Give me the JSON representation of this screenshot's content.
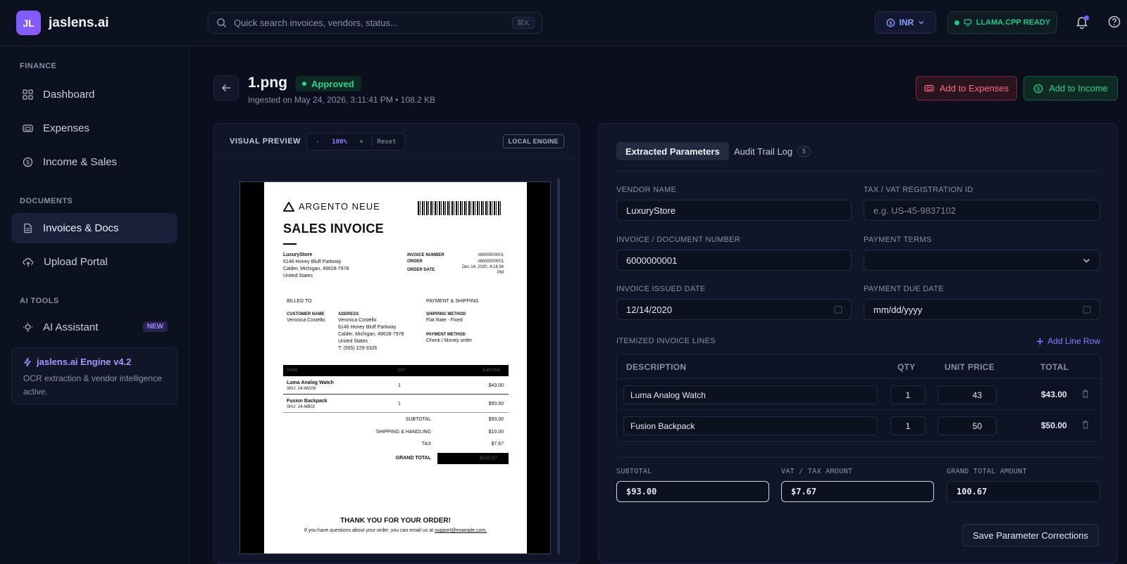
{
  "brand": {
    "logo": "JL",
    "name": "jaslens.ai"
  },
  "search": {
    "placeholder": "Quick search invoices, vendors, status...",
    "shortcut": "⌘K"
  },
  "topbar": {
    "currency": "INR",
    "llama_status": "LLAMA.CPP READY"
  },
  "sidebar": {
    "sections": [
      {
        "title": "FINANCE"
      },
      {
        "title": "DOCUMENTS"
      },
      {
        "title": "AI TOOLS"
      }
    ],
    "items": [
      {
        "label": "Dashboard",
        "icon": "grid-icon"
      },
      {
        "label": "Expenses",
        "icon": "wallet-icon"
      },
      {
        "label": "Income & Sales",
        "icon": "dollar-circle-icon"
      },
      {
        "label": "Invoices & Docs",
        "icon": "document-icon",
        "active": true
      },
      {
        "label": "Upload Portal",
        "icon": "cloud-upload-icon"
      },
      {
        "label": "AI Assistant",
        "icon": "lightbulb-icon",
        "badge": "NEW"
      }
    ],
    "engine": {
      "title": "jaslens.ai Engine v4.2",
      "desc": "OCR extraction & vendor intelligence active."
    }
  },
  "header": {
    "file_name": "1.png",
    "status": "Approved",
    "ingested": "Ingested on May 24, 2026, 3:11:41 PM • 108.2 KB",
    "add_expenses": "Add to Expenses",
    "add_income": "Add to Income"
  },
  "preview": {
    "label": "VISUAL PREVIEW",
    "zoom_minus": "-",
    "zoom_level": "100%",
    "zoom_plus": "+",
    "reset": "Reset",
    "engine_tag": "LOCAL ENGINE",
    "paper": {
      "brand": "ARGENTO NEUE",
      "title": "SALES INVOICE",
      "vendor": "LuxuryStore",
      "vendor_addr1": "6146 Honey Bluff Parkway",
      "vendor_addr2": "Calder, Michigan, 49628-7978",
      "vendor_addr3": "United States",
      "inv_label": "INVOICE NUMBER",
      "order_label": "ORDER",
      "date_label": "ORDER DATE",
      "inv_value": "#6000000001",
      "order_value": "#6000000001",
      "date_value": "Dec 14, 2020, 4:18:34 PM",
      "billed_to": "BILLED TO",
      "payment_shipping": "PAYMENT & SHIPPING",
      "customer_label": "CUSTOMER NAME",
      "customer": "Veronica Costello",
      "address_label": "ADDRESS",
      "addr1": "Veronica Costello",
      "addr2": "6146 Honey Bluff Parkway",
      "addr3": "Calder, Michigan, 49628-7978",
      "addr4": "United States",
      "addr5": "T: (555) 229-3326",
      "ship_method_label": "SHIPPING METHOD",
      "ship_method": "Flat Rate - Fixed",
      "pay_method_label": "PAYMENT METHOD",
      "pay_method": "Check / Money order",
      "th_item": "ITEMS",
      "th_qty": "QTY",
      "th_subtotal": "SUBTOTAL",
      "item1": "Luma Analog Watch",
      "sku1": "SKU: 24-WG09",
      "qty1": "1",
      "price1": "$43.00",
      "item2": "Fusion Backpack",
      "sku2": "SKU: 24-MB02",
      "qty2": "1",
      "price2": "$50.00",
      "subtotal_label": "SUBTOTAL",
      "subtotal": "$93.00",
      "shipping_label": "SHIPPING & HANDLING",
      "shipping": "$10.00",
      "tax_label": "TAX",
      "tax": "$7.67",
      "grand_label": "GRAND TOTAL",
      "grand": "$110.67",
      "thanks": "THANK YOU FOR YOUR ORDER!",
      "footer": "If you have questions about your order, you can email us at",
      "footer_email": "support@example.com."
    }
  },
  "params": {
    "tab_extracted": "Extracted Parameters",
    "tab_audit": "Audit Trail Log",
    "audit_count": "5",
    "vendor_label": "VENDOR NAME",
    "vendor_value": "LuxuryStore",
    "tax_id_label": "TAX / VAT REGISTRATION ID",
    "tax_id_placeholder": "e.g. US-45-9837102",
    "invoice_no_label": "INVOICE / DOCUMENT NUMBER",
    "invoice_no_value": "6000000001",
    "terms_label": "PAYMENT TERMS",
    "terms_value": "",
    "issued_label": "INVOICE ISSUED DATE",
    "issued_value": "12/14/2020",
    "due_label": "PAYMENT DUE DATE",
    "due_value": "mm/dd/yyyy",
    "lines_label": "ITEMIZED INVOICE LINES",
    "add_line": "Add Line Row",
    "columns": {
      "description": "DESCRIPTION",
      "qty": "QTY",
      "unit_price": "UNIT PRICE",
      "total": "TOTAL"
    },
    "lines": [
      {
        "description": "Luma Analog Watch",
        "qty": "1",
        "unit_price": "43",
        "total": "$43.00"
      },
      {
        "description": "Fusion Backpack",
        "qty": "1",
        "unit_price": "50",
        "total": "$50.00"
      }
    ],
    "subtotal_label": "SUBTOTAL",
    "subtotal_value": "$93.00",
    "vat_label": "VAT / TAX AMOUNT",
    "vat_value": "$7.67",
    "grand_label": "GRAND TOTAL AMOUNT",
    "grand_value": "100.67",
    "save": "Save Parameter Corrections"
  },
  "colors": {
    "accent": "#7c5cff",
    "success": "#22c58e",
    "danger": "#ff6b82",
    "background": "#0b0f1d"
  }
}
